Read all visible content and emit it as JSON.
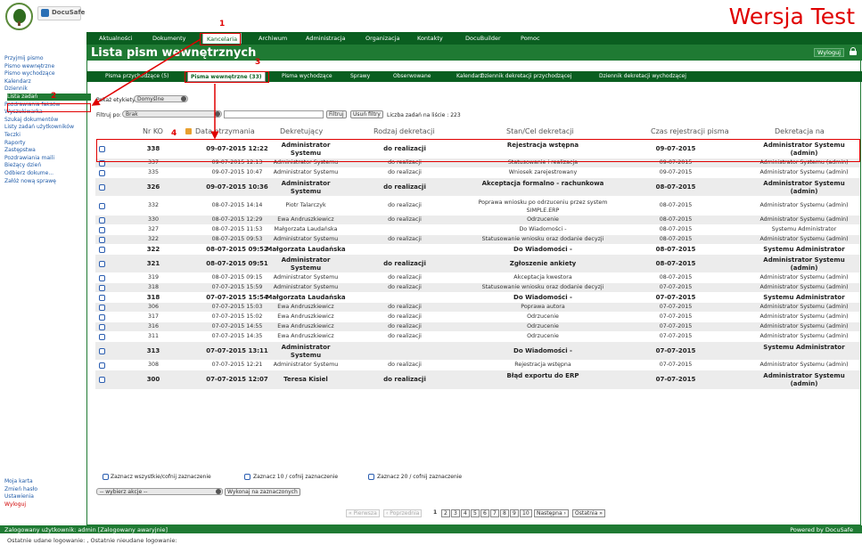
{
  "header": {
    "brand": "DocuSafe",
    "test_banner": "Wersja Test"
  },
  "topnav": [
    "Aktualności",
    "Dokumenty",
    "Kancelaria",
    "Archiwum",
    "Administracja",
    "Organizacja",
    "Kontakty",
    "DocuBuilder",
    "Pomoc"
  ],
  "page_title": "Lista pism wewnętrznych",
  "logout": "Wyloguj",
  "subtabs": [
    "Pisma przychodzące (5)",
    "Pisma wewnętrzne (33)",
    "Pisma wychodzące",
    "Sprawy",
    "Obserwowane",
    "Kalendarz",
    "Dziennik dekretacji przychodzącej",
    "Dziennik dekretacji wychodzącej"
  ],
  "sidebar": {
    "items": [
      "Przyjmij pismo",
      "Pismo wewnętrzne",
      "Pismo wychodzące",
      "Kalendarz",
      "Dziennik",
      "Lista zadań",
      "Pozdrawiania faksów",
      "Wyszukiwarka",
      "Szukaj dokumentów",
      "Listy zadań użytkowników",
      "Teczki",
      "Raporty",
      "Zastępstwa",
      "Pozdrawiania maili",
      "Bieżący dzień",
      "Odbierz dokume...",
      "Załóż nową sprawę"
    ],
    "bottom": [
      "Moja karta",
      "Zmień hasło",
      "Ustawienia",
      "Wyloguj"
    ]
  },
  "filters": {
    "show_label": "Pokaż etykiety",
    "show_value": "Domyślne",
    "filter_label": "Filtruj po:",
    "filter_value": "Brak",
    "filter_btn": "Filtruj",
    "clear_btn": "Usuń filtry",
    "count_text": "Liczba zadań na liście : 223"
  },
  "columns": [
    "Nr KO",
    "Data otrzymania",
    "Dekretujący",
    "Rodzaj dekretacji",
    "Stan/Cel dekretacji",
    "Czas rejestracji pisma",
    "Dekretacja na"
  ],
  "rows": [
    {
      "nr": "338",
      "date": "09-07-2015 12:22",
      "dekr": "Administrator Systemu",
      "rodzaj": "do realizacji",
      "stan": "Rejestracja wstępna",
      "czas": "09-07-2015",
      "na": "Administrator Systemu (admin)",
      "bold": true
    },
    {
      "nr": "337",
      "date": "09-07-2015 12:13",
      "dekr": "Administrator Systemu",
      "rodzaj": "do realizacji",
      "stan": "Statusowanie i realizacja",
      "czas": "09-07-2015",
      "na": "Administrator Systemu (admin)",
      "bold": false
    },
    {
      "nr": "335",
      "date": "09-07-2015 10:47",
      "dekr": "Administrator Systemu",
      "rodzaj": "do realizacji",
      "stan": "Wniosek zarejestrowany",
      "czas": "09-07-2015",
      "na": "Administrator Systemu (admin)",
      "bold": false
    },
    {
      "nr": "326",
      "date": "09-07-2015 10:36",
      "dekr": "Administrator Systemu",
      "rodzaj": "do realizacji",
      "stan": "Akceptacja formalno - rachunkowa",
      "czas": "08-07-2015",
      "na": "Administrator Systemu (admin)",
      "bold": true
    },
    {
      "nr": "332",
      "date": "08-07-2015 14:14",
      "dekr": "Piotr Talarczyk",
      "rodzaj": "do realizacji",
      "stan": "Poprawa wniosku po odrzuceniu przez system SIMPLE.ERP",
      "czas": "08-07-2015",
      "na": "Administrator Systemu (admin)",
      "bold": false
    },
    {
      "nr": "330",
      "date": "08-07-2015 12:29",
      "dekr": "Ewa Andruszkiewicz",
      "rodzaj": "do realizacji",
      "stan": "Odrzucenie",
      "czas": "08-07-2015",
      "na": "Administrator Systemu (admin)",
      "bold": false
    },
    {
      "nr": "327",
      "date": "08-07-2015 11:53",
      "dekr": "Małgorzata Laudańska",
      "rodzaj": "",
      "stan": "Do Wiadomości -",
      "czas": "08-07-2015",
      "na": "Systemu Administrator",
      "bold": false
    },
    {
      "nr": "322",
      "date": "08-07-2015 09:53",
      "dekr": "Administrator Systemu",
      "rodzaj": "do realizacji",
      "stan": "Statusowanie wniosku oraz dodanie decyzji",
      "czas": "08-07-2015",
      "na": "Administrator Systemu (admin)",
      "bold": false
    },
    {
      "nr": "322",
      "date": "08-07-2015 09:52",
      "dekr": "Małgorzata Laudańska",
      "rodzaj": "",
      "stan": "Do Wiadomości -",
      "czas": "08-07-2015",
      "na": "Systemu Administrator",
      "bold": true
    },
    {
      "nr": "321",
      "date": "08-07-2015 09:51",
      "dekr": "Administrator Systemu",
      "rodzaj": "do realizacji",
      "stan": "Zgłoszenie ankiety",
      "czas": "08-07-2015",
      "na": "Administrator Systemu (admin)",
      "bold": true
    },
    {
      "nr": "319",
      "date": "08-07-2015 09:15",
      "dekr": "Administrator Systemu",
      "rodzaj": "do realizacji",
      "stan": "Akceptacja kwestora",
      "czas": "08-07-2015",
      "na": "Administrator Systemu (admin)",
      "bold": false
    },
    {
      "nr": "318",
      "date": "07-07-2015 15:59",
      "dekr": "Administrator Systemu",
      "rodzaj": "do realizacji",
      "stan": "Statusowanie wniosku oraz dodanie decyzji",
      "czas": "07-07-2015",
      "na": "Administrator Systemu (admin)",
      "bold": false
    },
    {
      "nr": "318",
      "date": "07-07-2015 15:54",
      "dekr": "Małgorzata Laudańska",
      "rodzaj": "",
      "stan": "Do Wiadomości -",
      "czas": "07-07-2015",
      "na": "Systemu Administrator",
      "bold": true
    },
    {
      "nr": "306",
      "date": "07-07-2015 15:03",
      "dekr": "Ewa Andruszkiewicz",
      "rodzaj": "do realizacji",
      "stan": "Poprawa autora",
      "czas": "07-07-2015",
      "na": "Administrator Systemu (admin)",
      "bold": false
    },
    {
      "nr": "317",
      "date": "07-07-2015 15:02",
      "dekr": "Ewa Andruszkiewicz",
      "rodzaj": "do realizacji",
      "stan": "Odrzucenie",
      "czas": "07-07-2015",
      "na": "Administrator Systemu (admin)",
      "bold": false
    },
    {
      "nr": "316",
      "date": "07-07-2015 14:55",
      "dekr": "Ewa Andruszkiewicz",
      "rodzaj": "do realizacji",
      "stan": "Odrzucenie",
      "czas": "07-07-2015",
      "na": "Administrator Systemu (admin)",
      "bold": false
    },
    {
      "nr": "311",
      "date": "07-07-2015 14:35",
      "dekr": "Ewa Andruszkiewicz",
      "rodzaj": "do realizacji",
      "stan": "Odrzucenie",
      "czas": "07-07-2015",
      "na": "Administrator Systemu (admin)",
      "bold": false
    },
    {
      "nr": "313",
      "date": "07-07-2015 13:11",
      "dekr": "Administrator Systemu",
      "rodzaj": "",
      "stan": "Do Wiadomości -",
      "czas": "07-07-2015",
      "na": "Systemu Administrator",
      "bold": true
    },
    {
      "nr": "308",
      "date": "07-07-2015 12:21",
      "dekr": "Administrator Systemu",
      "rodzaj": "do realizacji",
      "stan": "Rejestracja wstępna",
      "czas": "07-07-2015",
      "na": "Administrator Systemu (admin)",
      "bold": false
    },
    {
      "nr": "300",
      "date": "07-07-2015 12:07",
      "dekr": "Teresa Kisiel",
      "rodzaj": "do realizacji",
      "stan": "Błąd exportu do ERP",
      "czas": "07-07-2015",
      "na": "Administrator Systemu (admin)",
      "bold": true
    }
  ],
  "bulk": {
    "select_all": "Zaznacz wszystkie/cofnij zaznaczenie",
    "select_10": "Zaznacz 10 / cofnij zaznaczenie",
    "select_20": "Zaznacz 20 / cofnij zaznaczenie",
    "action_placeholder": "-- wybierz akcje --",
    "run_btn": "Wykonaj na zaznaczonych"
  },
  "pagination": {
    "first": "« Pierwsza",
    "prev": "‹ Poprzednia",
    "pages": [
      "1",
      "2",
      "3",
      "4",
      "5",
      "6",
      "7",
      "8",
      "9",
      "10"
    ],
    "next": "Następna ›",
    "last": "Ostatnia »"
  },
  "status": {
    "user": "Zalogowany użytkownik: admin [Zalogowany awaryjnie]",
    "powered": "Powered by DocuSafe",
    "last_login": "Ostatnie udane logowanie: , Ostatnie nieudane logowanie:"
  },
  "annotations": [
    "1",
    "2",
    "3",
    "4"
  ],
  "colors": {
    "primary": "#1f7a33",
    "dark": "#0a5e20",
    "accent_red": "#e00000",
    "link": "#1e5aa8"
  }
}
